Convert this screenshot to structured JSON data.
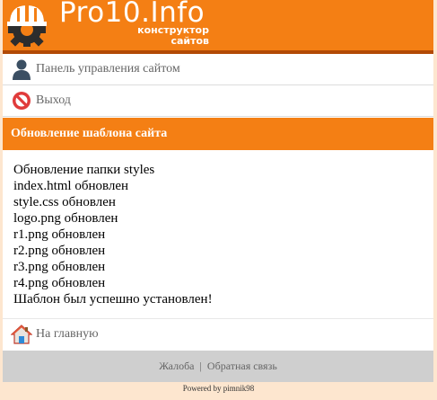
{
  "header": {
    "brand": "Pro10.Info",
    "tagline_line1": "конструктор",
    "tagline_line2": "сайтов",
    "logo_icon": "gear-helmet-icon"
  },
  "menu": [
    {
      "label": "Панель управления сайтом",
      "icon": "user-icon"
    },
    {
      "label": "Выход",
      "icon": "no-entry-icon"
    }
  ],
  "section": {
    "title": "Обновление шаблона сайта"
  },
  "log": [
    "Обновление папки styles",
    "index.html обновлен",
    "style.css обновлен",
    "logo.png обновлен",
    "r1.png обновлен",
    "r2.png обновлен",
    "r3.png обновлен",
    "r4.png обновлен",
    "Шаблон был успешно установлен!"
  ],
  "home": {
    "label": "На главную",
    "icon": "home-icon"
  },
  "footer": {
    "complaint": "Жалоба",
    "separator": "|",
    "feedback": "Обратная связь",
    "powered": "Powered by pimnik98"
  },
  "colors": {
    "accent": "#f47f14",
    "accent_dark": "#b24a06",
    "background": "#fde6cf",
    "footer_bg": "#cfcfcf"
  }
}
